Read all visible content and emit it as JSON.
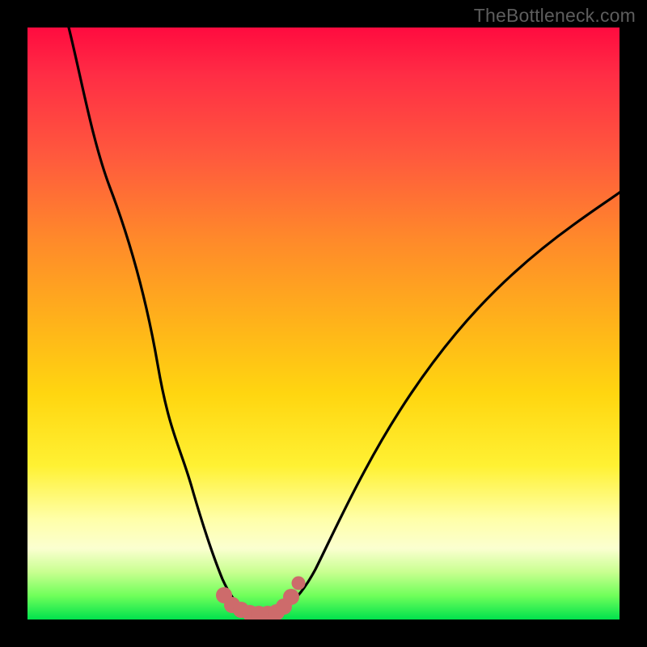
{
  "watermark": "TheBottleneck.com",
  "colors": {
    "frame": "#000000",
    "curve": "#000000",
    "markers": "#cd6b6b",
    "gradient_top": "#ff0b3f",
    "gradient_bottom": "#00e24d"
  },
  "chart_data": {
    "type": "line",
    "title": "",
    "xlabel": "",
    "ylabel": "",
    "xlim": [
      0,
      100
    ],
    "ylim": [
      0,
      100
    ],
    "grid": false,
    "legend": false,
    "note": "V-shaped bottleneck curve over heatmap gradient. Values estimated from pixel positions (no axis labels in image). y=0 is bottom (green), y=100 is top (red).",
    "series": [
      {
        "name": "bottleneck-curve",
        "color": "#000000",
        "x": [
          7,
          10,
          14,
          18,
          22,
          26,
          29,
          31,
          33,
          34.5,
          36,
          38,
          40,
          42,
          45,
          48,
          52,
          57,
          63,
          70,
          78,
          87,
          97
        ],
        "y": [
          100,
          88,
          73,
          58,
          43,
          29,
          18,
          11,
          6,
          3,
          1.5,
          0.8,
          0.8,
          1.5,
          4,
          9,
          16,
          24,
          33,
          42,
          50,
          57,
          63
        ]
      },
      {
        "name": "optimal-region-markers",
        "color": "#cd6b6b",
        "type": "scatter",
        "x": [
          33.2,
          34.5,
          36,
          37.5,
          39,
          40.5,
          42,
          43.3,
          44.6,
          45.8
        ],
        "y": [
          3.8,
          2.0,
          1.2,
          0.9,
          0.9,
          0.9,
          1.2,
          2.2,
          4.0,
          6.2
        ]
      }
    ]
  }
}
